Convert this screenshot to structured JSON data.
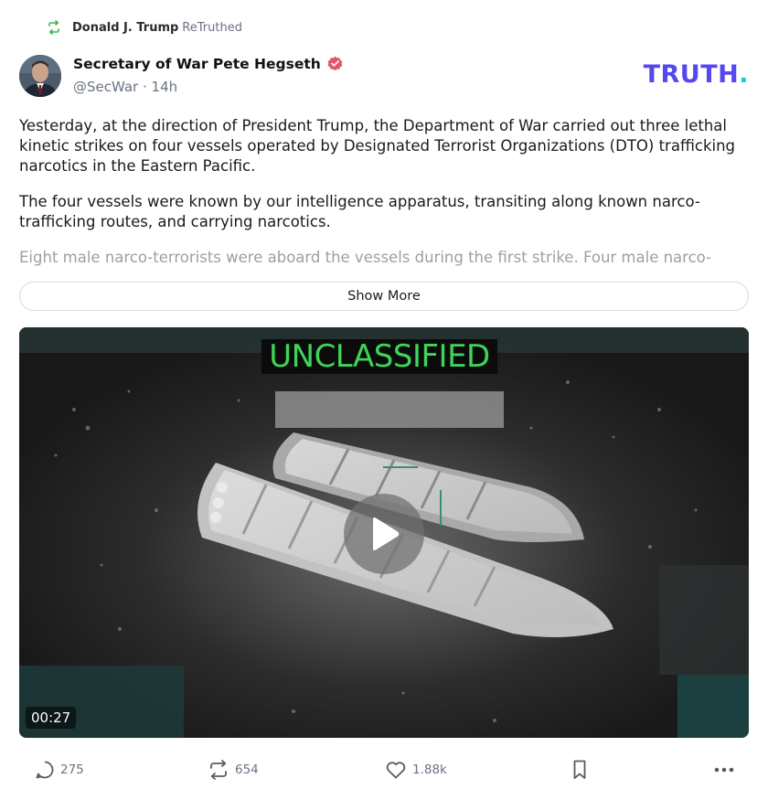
{
  "retruth": {
    "user": "Donald J. Trump",
    "label": "ReTruthed"
  },
  "author": {
    "name": "Secretary of War Pete Hegseth",
    "handle": "@SecWar",
    "age": "14h",
    "meta": "@SecWar · 14h",
    "verified": true
  },
  "brand": {
    "logo_text": "TRUTH",
    "logo_dot": ".",
    "color": "#5448ee",
    "dot_color": "#0ecfd6"
  },
  "post": {
    "paragraphs": [
      "Yesterday, at the direction of President Trump, the Department of War carried out three lethal kinetic strikes on four vessels operated by Designated Terrorist Organizations (DTO) trafficking narcotics in the Eastern Pacific.",
      "The four vessels were known by our intelligence apparatus, transiting along known narco-trafficking routes, and carrying narcotics.",
      "Eight male narco-terrorists were aboard the vessels during the first strike. Four male narco-"
    ],
    "show_more_label": "Show More"
  },
  "video": {
    "overlay_text": "UNCLASSIFIED",
    "duration": "00:27",
    "play_icon": "play-icon"
  },
  "actions": {
    "replies": "275",
    "retruths": "654",
    "likes": "1.88k",
    "icons": [
      "comment-icon",
      "retruth-icon",
      "heart-icon",
      "bookmark-icon",
      "more-icon"
    ]
  }
}
